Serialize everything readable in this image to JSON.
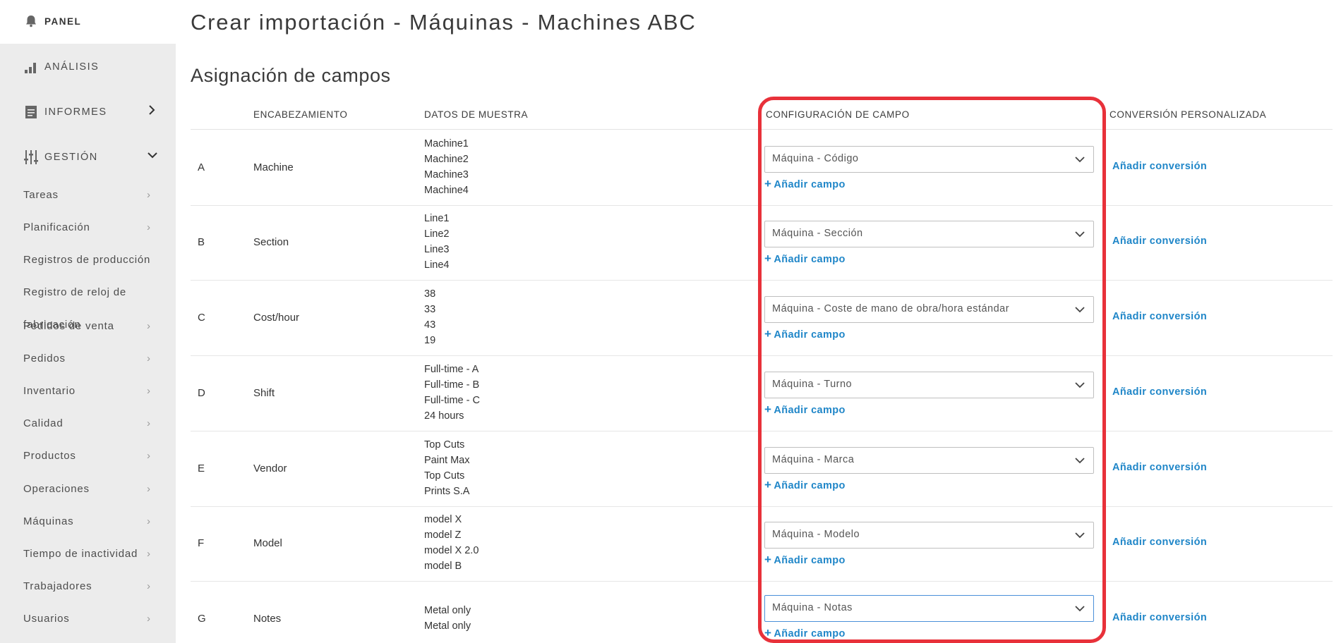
{
  "sidebar": {
    "panel": "PANEL",
    "analysis": "ANÁLISIS",
    "reports": "INFORMES",
    "management": "GESTIÓN",
    "sub_items": [
      {
        "label": "Tareas"
      },
      {
        "label": "Planificación"
      },
      {
        "label": "Registros de producción"
      },
      {
        "label": "Registro de reloj de"
      },
      {
        "label": "fabricación"
      },
      {
        "label": "Pedidos de venta"
      },
      {
        "label": "Pedidos"
      },
      {
        "label": "Inventario"
      },
      {
        "label": "Calidad"
      },
      {
        "label": "Productos"
      },
      {
        "label": "Operaciones"
      },
      {
        "label": "Máquinas"
      },
      {
        "label": "Tiempo de inactividad"
      },
      {
        "label": "Trabajadores"
      },
      {
        "label": "Usuarios"
      }
    ]
  },
  "page": {
    "title": "Crear importación - Máquinas - Machines ABC",
    "section_title": "Asignación de campos"
  },
  "table": {
    "headers": {
      "heading": "ENCABEZAMIENTO",
      "sample_data": "DATOS DE MUESTRA",
      "field_config": "CONFIGURACIÓN DE CAMPO",
      "custom_conversion": "CONVERSIÓN PERSONALIZADA"
    },
    "add_field_label": "Añadir campo",
    "add_conversion_label": "Añadir conversión",
    "rows": [
      {
        "letter": "A",
        "heading": "Machine",
        "samples": [
          "Machine1",
          "Machine2",
          "Machine3",
          "Machine4"
        ],
        "field": "Máquina - Código"
      },
      {
        "letter": "B",
        "heading": "Section",
        "samples": [
          "Line1",
          "Line2",
          "Line3",
          "Line4"
        ],
        "field": "Máquina - Sección"
      },
      {
        "letter": "C",
        "heading": "Cost/hour",
        "samples": [
          "38",
          "33",
          "43",
          "19"
        ],
        "field": "Máquina - Coste de mano de obra/hora estándar"
      },
      {
        "letter": "D",
        "heading": "Shift",
        "samples": [
          "Full-time - A",
          "Full-time - B",
          "Full-time - C",
          "24 hours"
        ],
        "field": "Máquina - Turno"
      },
      {
        "letter": "E",
        "heading": "Vendor",
        "samples": [
          "Top Cuts",
          "Paint Max",
          "Top Cuts",
          "Prints S.A"
        ],
        "field": "Máquina - Marca"
      },
      {
        "letter": "F",
        "heading": "Model",
        "samples": [
          "model X",
          "model Z",
          "model X 2.0",
          "model B"
        ],
        "field": "Máquina - Modelo"
      },
      {
        "letter": "G",
        "heading": "Notes",
        "samples": [
          "Metal only",
          "Metal only"
        ],
        "field": "Máquina - Notas"
      }
    ]
  },
  "colors": {
    "accent": "#1f86c8",
    "highlight": "#e8313a",
    "sidebar_bg": "#ececec"
  }
}
